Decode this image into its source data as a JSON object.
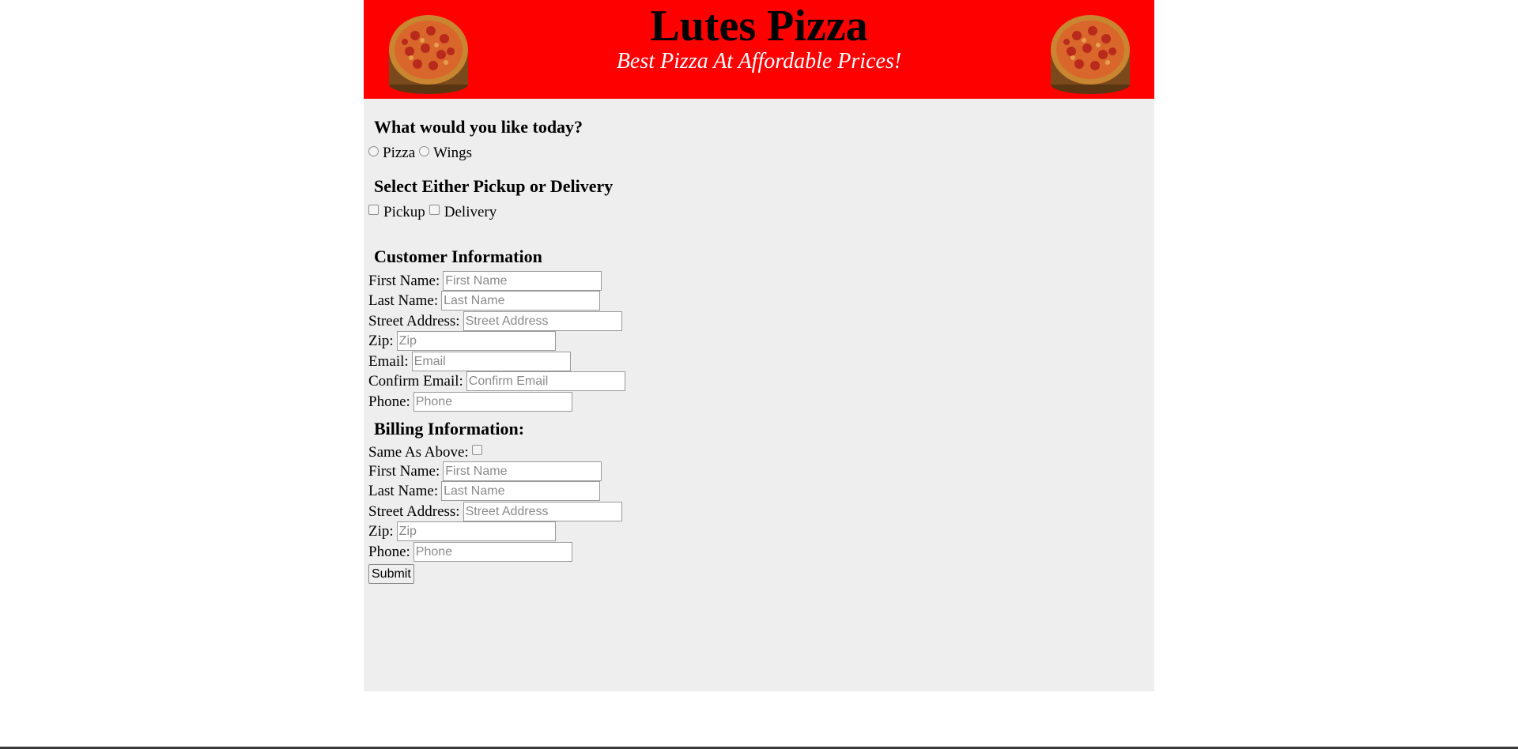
{
  "header": {
    "title": "Lutes Pizza",
    "tagline": "Best Pizza At Affordable Prices!",
    "left_image": "pizza-image",
    "right_image": "pizza-image",
    "background_color": "#ff0000"
  },
  "order_type": {
    "heading": "What would you like today?",
    "options": [
      "Pizza",
      "Wings"
    ]
  },
  "fulfillment": {
    "heading": "Select Either Pickup or Delivery",
    "options": [
      "Pickup",
      "Delivery"
    ]
  },
  "customer": {
    "heading": "Customer Information",
    "fields": [
      {
        "label": "First Name:",
        "placeholder": "First Name",
        "value": ""
      },
      {
        "label": "Last Name:",
        "placeholder": "Last Name",
        "value": ""
      },
      {
        "label": "Street Address:",
        "placeholder": "Street Address",
        "value": ""
      },
      {
        "label": "Zip:",
        "placeholder": "Zip",
        "value": ""
      },
      {
        "label": "Email:",
        "placeholder": "Email",
        "value": ""
      },
      {
        "label": "Confirm Email:",
        "placeholder": "Confirm Email",
        "value": ""
      },
      {
        "label": "Phone:",
        "placeholder": "Phone",
        "value": ""
      }
    ]
  },
  "billing": {
    "heading": "Billing Information:",
    "same_as_above_label": "Same As Above:",
    "fields": [
      {
        "label": "First Name:",
        "placeholder": "First Name",
        "value": ""
      },
      {
        "label": "Last Name:",
        "placeholder": "Last Name",
        "value": ""
      },
      {
        "label": "Street Address:",
        "placeholder": "Street Address",
        "value": ""
      },
      {
        "label": "Zip:",
        "placeholder": "Zip",
        "value": ""
      },
      {
        "label": "Phone:",
        "placeholder": "Phone",
        "value": ""
      }
    ]
  },
  "submit_label": "Submit"
}
